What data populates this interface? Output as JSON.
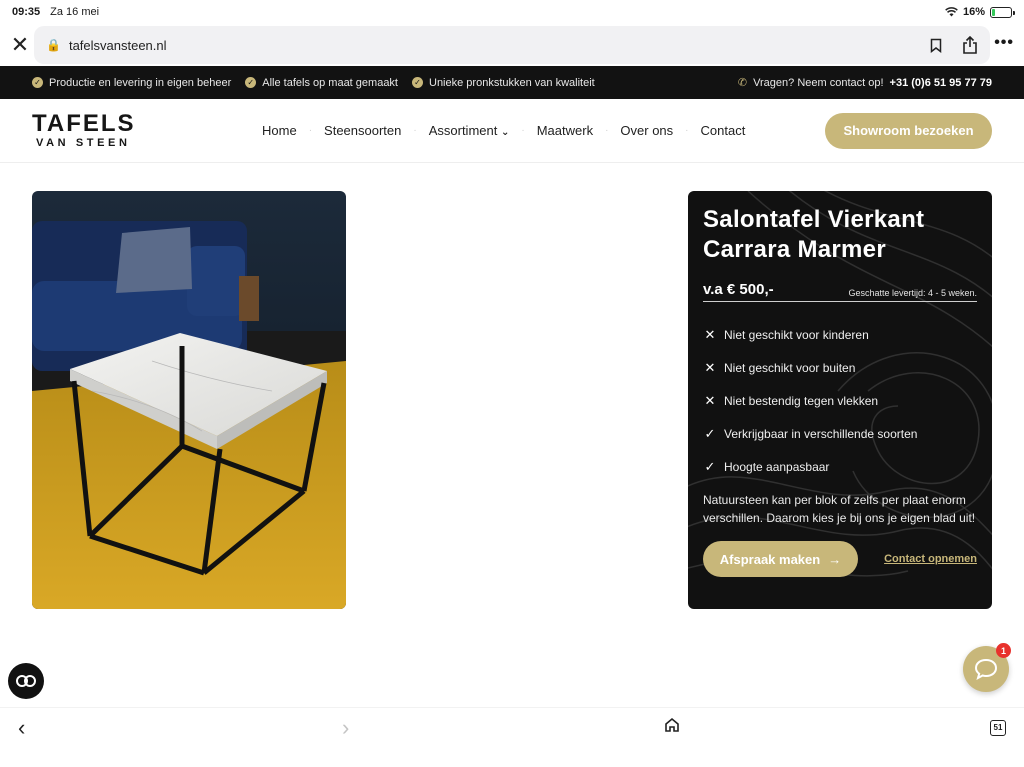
{
  "status_bar": {
    "time": "09:35",
    "date": "Za 16 mei",
    "battery": "16%",
    "battery_level": 0.16
  },
  "browser": {
    "url": "tafelsvansteen.nl",
    "tabs_count": "51"
  },
  "topbar": {
    "usps": [
      "Productie en levering in eigen beheer",
      "Alle tafels op maat gemaakt",
      "Unieke pronkstukken van kwaliteit"
    ],
    "contact_text": "Vragen? Neem contact op!",
    "phone": "+31 (0)6 51 95 77 79"
  },
  "logo": {
    "line1": "TAFELS",
    "line2": "VAN STEEN"
  },
  "nav": {
    "items": [
      "Home",
      "Steensoorten",
      "Assortiment",
      "Maatwerk",
      "Over ons",
      "Contact"
    ],
    "cta": "Showroom bezoeken"
  },
  "product": {
    "title_line1": "Salontafel Vierkant",
    "title_line2": "Carrara Marmer",
    "price": "v.a € 500,-",
    "delivery": "Geschatte levertijd: 4 - 5 weken.",
    "features": [
      {
        "icon": "x-icon",
        "text": "Niet geschikt voor kinderen"
      },
      {
        "icon": "x-icon",
        "text": "Niet geschikt voor buiten"
      },
      {
        "icon": "x-icon",
        "text": "Niet bestendig tegen vlekken"
      },
      {
        "icon": "check-icon",
        "text": "Verkrijgbaar in verschillende soorten"
      },
      {
        "icon": "check-icon",
        "text": "Hoogte aanpasbaar"
      }
    ],
    "description": "Natuursteen kan per blok of zelfs per plaat enorm verschillen. Daarom kies je bij ons je eigen blad uit!",
    "primary_action": "Afspraak maken",
    "secondary_action": "Contact opnemen"
  },
  "chat": {
    "badge": "1"
  },
  "colors": {
    "accent": "#c8b77a",
    "dark": "#111111",
    "badge": "#e8322d"
  }
}
